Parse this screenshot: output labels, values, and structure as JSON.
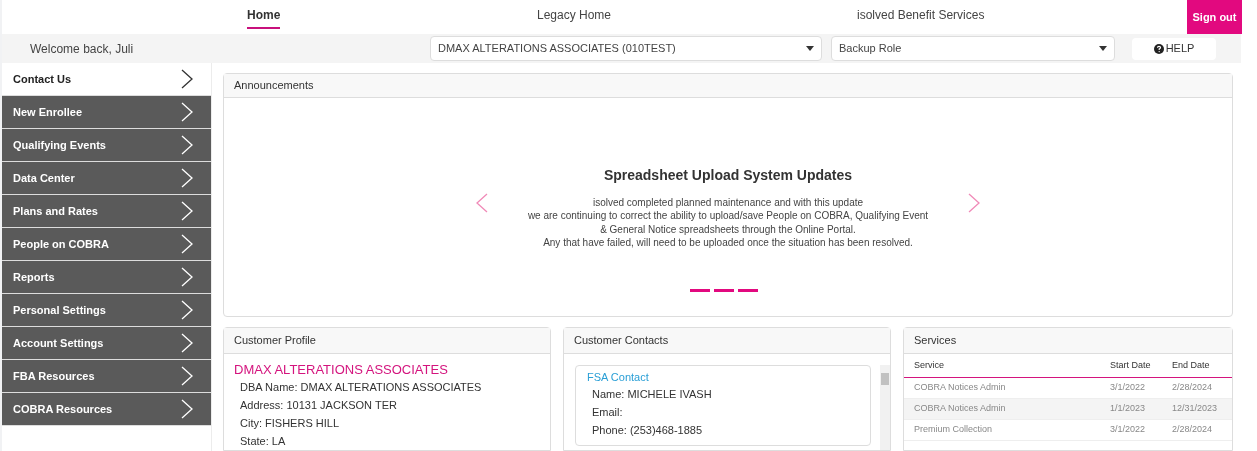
{
  "nav": {
    "tabs": [
      {
        "label": "Home",
        "selected": true
      },
      {
        "label": "Legacy Home",
        "selected": false
      },
      {
        "label": "isolved Benefit Services",
        "selected": false
      }
    ],
    "sign_out": "Sign out"
  },
  "toolbar": {
    "welcome": "Welcome back, Juli",
    "company_select": "DMAX ALTERATIONS ASSOCIATES (010TEST)",
    "role_select": "Backup Role",
    "help": "HELP"
  },
  "sidebar": {
    "items": [
      {
        "label": "Contact Us",
        "selected": true
      },
      {
        "label": "New Enrollee",
        "selected": false
      },
      {
        "label": "Qualifying Events",
        "selected": false
      },
      {
        "label": "Data Center",
        "selected": false
      },
      {
        "label": "Plans and Rates",
        "selected": false
      },
      {
        "label": "People on COBRA",
        "selected": false
      },
      {
        "label": "Reports",
        "selected": false
      },
      {
        "label": "Personal Settings",
        "selected": false
      },
      {
        "label": "Account Settings",
        "selected": false
      },
      {
        "label": "FBA Resources",
        "selected": false
      },
      {
        "label": "COBRA Resources",
        "selected": false
      }
    ]
  },
  "announcements": {
    "title": "Announcements",
    "headline": "Spreadsheet Upload System Updates",
    "lines": [
      "isolved completed planned maintenance and with this update",
      "we are continuing to correct the ability to upload/save People on COBRA, Qualifying Event",
      "& General Notice spreadsheets through the Online Portal.",
      "Any that have failed, will need to be uploaded once the situation has been resolved."
    ]
  },
  "customer_profile": {
    "title": "Customer Profile",
    "name": "DMAX ALTERATIONS ASSOCIATES",
    "fields": [
      "DBA Name: DMAX ALTERATIONS ASSOCIATES",
      "Address: 10131 JACKSON TER",
      "City: FISHERS HILL",
      "State: LA"
    ]
  },
  "customer_contacts": {
    "title": "Customer Contacts",
    "contacts": [
      {
        "type": "FSA Contact",
        "fields": [
          "Name: MICHELE IVASH",
          "Email:",
          "Phone: (253)468-1885"
        ]
      }
    ]
  },
  "services": {
    "title": "Services",
    "columns": [
      "Service",
      "Start Date",
      "End Date"
    ],
    "rows": [
      [
        "COBRA Notices Admin",
        "3/1/2022",
        "2/28/2024"
      ],
      [
        "COBRA Notices Admin",
        "1/1/2023",
        "12/31/2023"
      ],
      [
        "Premium Collection",
        "3/1/2022",
        "2/28/2024"
      ]
    ]
  }
}
